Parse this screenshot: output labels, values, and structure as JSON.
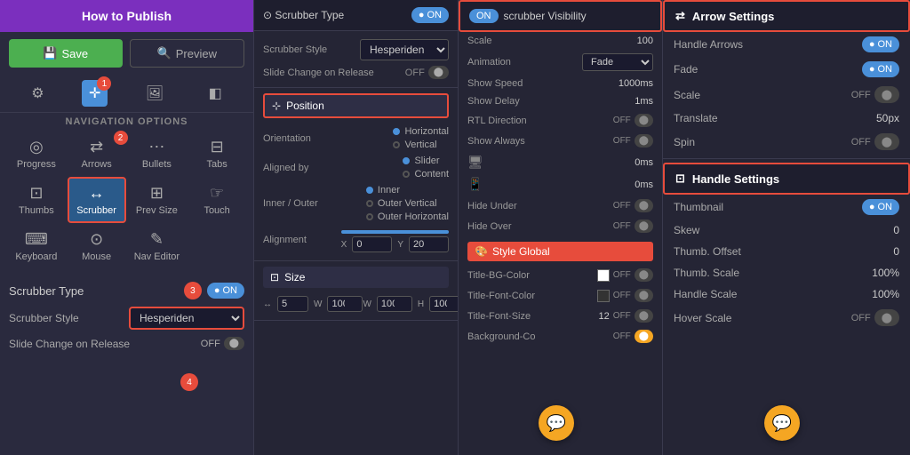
{
  "app": {
    "title": "How to Publish",
    "save_label": "Save",
    "preview_label": "Preview"
  },
  "nav_options": {
    "label": "NAVIGATION OPTIONS",
    "items": [
      {
        "id": "progress",
        "label": "Progress",
        "icon": "◎"
      },
      {
        "id": "arrows",
        "label": "Arrows",
        "icon": "←→"
      },
      {
        "id": "bullets",
        "label": "Bullets",
        "icon": "⋯"
      },
      {
        "id": "tabs",
        "label": "Tabs",
        "icon": "⊟"
      },
      {
        "id": "thumbs",
        "label": "Thumbs",
        "icon": "⊡"
      },
      {
        "id": "scrubber",
        "label": "Scrubber",
        "icon": "↔",
        "active": true
      },
      {
        "id": "prev_size",
        "label": "Prev Size",
        "icon": "⊞"
      },
      {
        "id": "touch",
        "label": "Touch",
        "icon": "☞"
      },
      {
        "id": "keyboard",
        "label": "Keyboard",
        "icon": "⌨"
      },
      {
        "id": "mouse",
        "label": "Mouse",
        "icon": "⊙"
      },
      {
        "id": "nav_editor",
        "label": "Nav Editor",
        "icon": "✎"
      }
    ]
  },
  "scrubber_type": {
    "label": "Scrubber Type",
    "toggle": "ON",
    "style_label": "Scrubber Style",
    "style_value": "Hesperiden",
    "slide_change_label": "Slide Change on Release",
    "slide_change_value": "OFF"
  },
  "position_section": {
    "title": "Position",
    "orientation_label": "Orientation",
    "orientation_options": [
      "Horizontal",
      "Vertical"
    ],
    "orientation_selected": "Horizontal",
    "aligned_by_label": "Aligned by",
    "aligned_by_options": [
      "Slider",
      "Content"
    ],
    "aligned_by_selected": "Slider",
    "inner_outer_label": "Inner / Outer",
    "inner_outer_options": [
      "Inner",
      "Outer Vertical",
      "Outer Horizontal"
    ],
    "inner_outer_selected": "Inner",
    "alignment_label": "Alignment",
    "x_label": "X",
    "x_value": "0",
    "y_label": "Y",
    "y_value": "20"
  },
  "size_section": {
    "title": "Size",
    "w1_value": "5",
    "w2_value": "100",
    "w3_value": "100",
    "h_value": "100"
  },
  "scrubber_visibility": {
    "tab_label": "scrubber Visibility",
    "toggle": "ON",
    "scale_label": "Scale",
    "scale_value": "100",
    "animation_label": "Animation",
    "animation_value": "Fade",
    "show_speed_label": "Show Speed",
    "show_speed_value": "1000ms",
    "show_delay_label": "Show Delay",
    "show_delay_value": "1ms",
    "rtl_label": "RTL Direction",
    "rtl_value": "OFF",
    "show_always_label": "Show Always",
    "show_always_value": "OFF",
    "monitor1_value": "0ms",
    "monitor2_value": "0ms",
    "hide_under_label": "Hide Under",
    "hide_under_value": "OFF",
    "hide_over_label": "Hide Over",
    "hide_over_value": "OFF"
  },
  "style_global": {
    "title": "Style Global",
    "title_bg_color_label": "Title-BG-Color",
    "title_font_color_label": "Title-Font-Color",
    "title_font_size_label": "Title-Font-Size",
    "title_font_size_value": "12",
    "bg_color_label": "Background-Co"
  },
  "arrow_settings": {
    "title": "Arrow Settings",
    "handle_arrows_label": "Handle Arrows",
    "handle_arrows_value": "ON",
    "fade_label": "Fade",
    "fade_value": "ON",
    "scale_label": "Scale",
    "scale_value": "OFF",
    "translate_label": "Translate",
    "translate_value": "50px",
    "spin_label": "Spin",
    "spin_value": "OFF"
  },
  "handle_settings": {
    "title": "Handle Settings",
    "thumbnail_label": "Thumbnail",
    "thumbnail_value": "ON",
    "skew_label": "Skew",
    "skew_value": "0",
    "thumb_offset_label": "Thumb. Offset",
    "thumb_offset_value": "0",
    "thumb_scale_label": "Thumb. Scale",
    "thumb_scale_value": "100%",
    "handle_scale_label": "Handle Scale",
    "handle_scale_value": "100%",
    "hover_scale_label": "Hover Scale",
    "hover_scale_value": "OFF"
  },
  "annotations": {
    "circle1": "1",
    "circle2": "2",
    "circle3": "3",
    "circle4": "4"
  }
}
